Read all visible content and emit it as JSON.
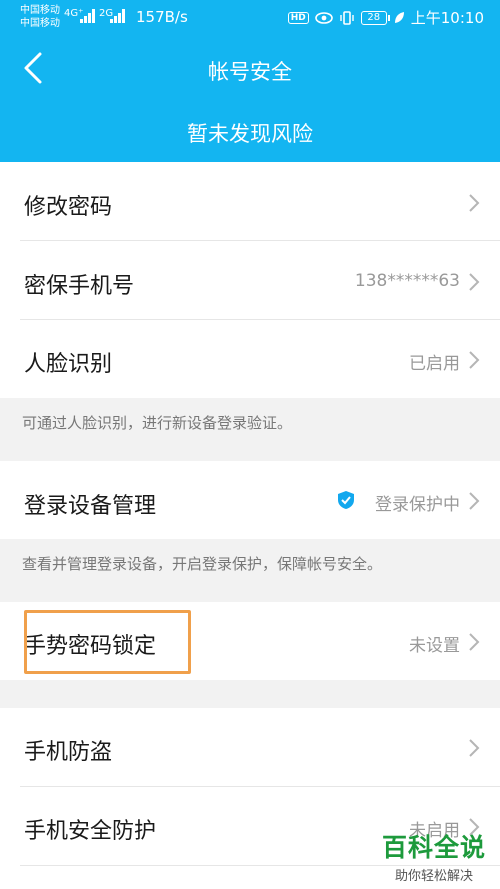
{
  "status_bar": {
    "carrier_1": "中国移动",
    "carrier_2": "中国移动",
    "net_1": "4G⁺",
    "net_2": "2G",
    "speed": "157B/s",
    "hd": "HD",
    "battery": "28",
    "time": "上午10:10"
  },
  "header": {
    "title": "帐号安全",
    "risk_text": "暂未发现风险"
  },
  "items": {
    "change_password": {
      "label": "修改密码"
    },
    "security_phone": {
      "label": "密保手机号",
      "value": "138******63"
    },
    "face_recognition": {
      "label": "人脸识别",
      "value": "已启用"
    },
    "face_note": "可通过人脸识别，进行新设备登录验证。",
    "device_management": {
      "label": "登录设备管理",
      "value": "登录保护中"
    },
    "device_note": "查看并管理登录设备，开启登录保护，保障帐号安全。",
    "gesture_lock": {
      "label": "手势密码锁定",
      "value": "未设置"
    },
    "anti_theft": {
      "label": "手机防盗"
    },
    "phone_protection": {
      "label": "手机安全防护",
      "value": "未启用"
    }
  },
  "watermark": {
    "title": "百科全说",
    "subtitle": "助你轻松解决"
  },
  "colors": {
    "header_bg": "#13b5f1",
    "highlight": "#f0a04b",
    "watermark": "#1d9a3c"
  }
}
